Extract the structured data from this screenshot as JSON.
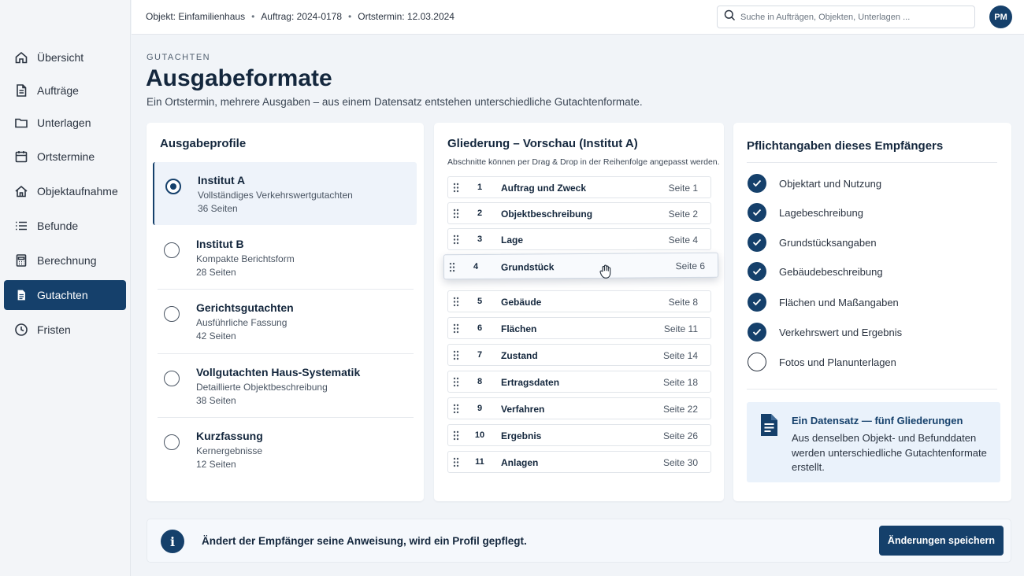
{
  "sidebar": {
    "items": [
      {
        "label": "Übersicht",
        "icon": "home-icon"
      },
      {
        "label": "Aufträge",
        "icon": "document-icon"
      },
      {
        "label": "Unterlagen",
        "icon": "folder-icon"
      },
      {
        "label": "Ortstermine",
        "icon": "calendar-icon"
      },
      {
        "label": "Objektaufnahme",
        "icon": "house-icon"
      },
      {
        "label": "Befunde",
        "icon": "list-icon"
      },
      {
        "label": "Berechnung",
        "icon": "calculator-icon"
      },
      {
        "label": "Gutachten",
        "icon": "report-icon",
        "active": true
      },
      {
        "label": "Fristen",
        "icon": "clock-icon"
      }
    ]
  },
  "topbar": {
    "object": "Objekt: Einfamilienhaus",
    "order": "Auftrag: 2024-0178",
    "appointment": "Ortstermin: 12.03.2024",
    "separator": "•",
    "search_placeholder": "Suche in Aufträgen, Objekten, Unterlagen ...",
    "avatar": "PM"
  },
  "header": {
    "eyebrow": "GUTACHTEN",
    "title": "Ausgabeformate",
    "subtitle": "Ein Ortstermin, mehrere Ausgaben – aus einem Datensatz entstehen unterschiedliche Gutachtenformate."
  },
  "profiles": {
    "title": "Ausgabeprofile",
    "items": [
      {
        "name": "Institut A",
        "desc": "Vollständiges Verkehrswertgutachten",
        "pages": "36 Seiten",
        "selected": true
      },
      {
        "name": "Institut B",
        "desc": "Kompakte Berichtsform",
        "pages": "28 Seiten",
        "selected": false
      },
      {
        "name": "Gerichtsgutachten",
        "desc": "Ausführliche Fassung",
        "pages": "42 Seiten",
        "selected": false
      },
      {
        "name": "Vollgutachten Haus-Systematik",
        "desc": "Detaillierte Objektbeschreibung",
        "pages": "38 Seiten",
        "selected": false
      },
      {
        "name": "Kurzfassung",
        "desc": "Kernergebnisse",
        "pages": "12 Seiten",
        "selected": false
      }
    ]
  },
  "outline": {
    "title": "Gliederung – Vorschau (Institut A)",
    "hint": "Abschnitte können per Drag & Drop in der Reihenfolge angepasst werden.",
    "rows": [
      {
        "num": "1",
        "label": "Auftrag und Zweck",
        "page": "Seite 1"
      },
      {
        "num": "2",
        "label": "Objektbeschreibung",
        "page": "Seite 2"
      },
      {
        "num": "3",
        "label": "Lage",
        "page": "Seite 4"
      },
      {
        "num": "4",
        "label": "Grundstück",
        "page": "Seite 6",
        "dragging": true
      },
      {
        "num": "5",
        "label": "Gebäude",
        "page": "Seite 8"
      },
      {
        "num": "6",
        "label": "Flächen",
        "page": "Seite 11"
      },
      {
        "num": "7",
        "label": "Zustand",
        "page": "Seite 14"
      },
      {
        "num": "8",
        "label": "Ertragsdaten",
        "page": "Seite 18"
      },
      {
        "num": "9",
        "label": "Verfahren",
        "page": "Seite 22"
      },
      {
        "num": "10",
        "label": "Ergebnis",
        "page": "Seite 26"
      },
      {
        "num": "11",
        "label": "Anlagen",
        "page": "Seite 30"
      }
    ]
  },
  "requirements": {
    "title": "Pflichtangaben dieses Empfängers",
    "items": [
      {
        "label": "Objektart und Nutzung",
        "done": true
      },
      {
        "label": "Lagebeschreibung",
        "done": true
      },
      {
        "label": "Grundstücksangaben",
        "done": true
      },
      {
        "label": "Gebäudebeschreibung",
        "done": true
      },
      {
        "label": "Flächen und Maßangaben",
        "done": true
      },
      {
        "label": "Verkehrswert und Ergebnis",
        "done": true
      },
      {
        "label": "Fotos und Planunterlagen",
        "done": false
      }
    ],
    "info_title": "Ein Datensatz — fünf Gliederungen",
    "info_text": "Aus denselben Objekt- und Befunddaten werden unterschiedliche Gutachtenformate erstellt."
  },
  "banner": {
    "icon": "i",
    "text": "Ändert der Empfänger seine Anweisung, wird ein Profil gepflegt.",
    "save_label": "Änderungen speichern"
  },
  "colors": {
    "accent": "#15406b",
    "background": "#f1f4f8"
  }
}
